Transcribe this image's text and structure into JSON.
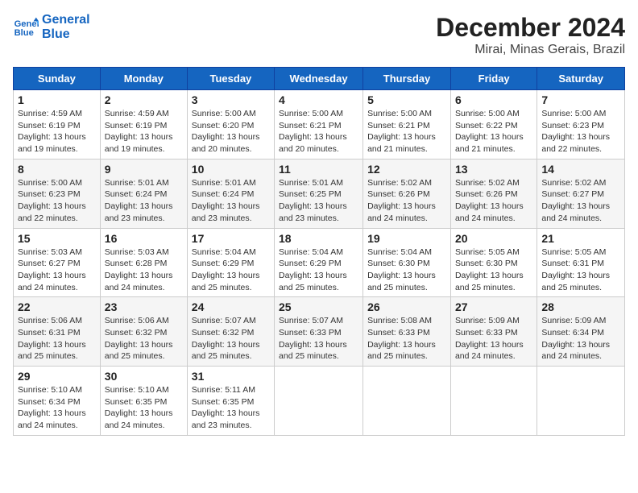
{
  "header": {
    "logo_line1": "General",
    "logo_line2": "Blue",
    "month": "December 2024",
    "location": "Mirai, Minas Gerais, Brazil"
  },
  "weekdays": [
    "Sunday",
    "Monday",
    "Tuesday",
    "Wednesday",
    "Thursday",
    "Friday",
    "Saturday"
  ],
  "weeks": [
    [
      {
        "day": 1,
        "detail": "Sunrise: 4:59 AM\nSunset: 6:19 PM\nDaylight: 13 hours\nand 19 minutes."
      },
      {
        "day": 2,
        "detail": "Sunrise: 4:59 AM\nSunset: 6:19 PM\nDaylight: 13 hours\nand 19 minutes."
      },
      {
        "day": 3,
        "detail": "Sunrise: 5:00 AM\nSunset: 6:20 PM\nDaylight: 13 hours\nand 20 minutes."
      },
      {
        "day": 4,
        "detail": "Sunrise: 5:00 AM\nSunset: 6:21 PM\nDaylight: 13 hours\nand 20 minutes."
      },
      {
        "day": 5,
        "detail": "Sunrise: 5:00 AM\nSunset: 6:21 PM\nDaylight: 13 hours\nand 21 minutes."
      },
      {
        "day": 6,
        "detail": "Sunrise: 5:00 AM\nSunset: 6:22 PM\nDaylight: 13 hours\nand 21 minutes."
      },
      {
        "day": 7,
        "detail": "Sunrise: 5:00 AM\nSunset: 6:23 PM\nDaylight: 13 hours\nand 22 minutes."
      }
    ],
    [
      {
        "day": 8,
        "detail": "Sunrise: 5:00 AM\nSunset: 6:23 PM\nDaylight: 13 hours\nand 22 minutes."
      },
      {
        "day": 9,
        "detail": "Sunrise: 5:01 AM\nSunset: 6:24 PM\nDaylight: 13 hours\nand 23 minutes."
      },
      {
        "day": 10,
        "detail": "Sunrise: 5:01 AM\nSunset: 6:24 PM\nDaylight: 13 hours\nand 23 minutes."
      },
      {
        "day": 11,
        "detail": "Sunrise: 5:01 AM\nSunset: 6:25 PM\nDaylight: 13 hours\nand 23 minutes."
      },
      {
        "day": 12,
        "detail": "Sunrise: 5:02 AM\nSunset: 6:26 PM\nDaylight: 13 hours\nand 24 minutes."
      },
      {
        "day": 13,
        "detail": "Sunrise: 5:02 AM\nSunset: 6:26 PM\nDaylight: 13 hours\nand 24 minutes."
      },
      {
        "day": 14,
        "detail": "Sunrise: 5:02 AM\nSunset: 6:27 PM\nDaylight: 13 hours\nand 24 minutes."
      }
    ],
    [
      {
        "day": 15,
        "detail": "Sunrise: 5:03 AM\nSunset: 6:27 PM\nDaylight: 13 hours\nand 24 minutes."
      },
      {
        "day": 16,
        "detail": "Sunrise: 5:03 AM\nSunset: 6:28 PM\nDaylight: 13 hours\nand 24 minutes."
      },
      {
        "day": 17,
        "detail": "Sunrise: 5:04 AM\nSunset: 6:29 PM\nDaylight: 13 hours\nand 25 minutes."
      },
      {
        "day": 18,
        "detail": "Sunrise: 5:04 AM\nSunset: 6:29 PM\nDaylight: 13 hours\nand 25 minutes."
      },
      {
        "day": 19,
        "detail": "Sunrise: 5:04 AM\nSunset: 6:30 PM\nDaylight: 13 hours\nand 25 minutes."
      },
      {
        "day": 20,
        "detail": "Sunrise: 5:05 AM\nSunset: 6:30 PM\nDaylight: 13 hours\nand 25 minutes."
      },
      {
        "day": 21,
        "detail": "Sunrise: 5:05 AM\nSunset: 6:31 PM\nDaylight: 13 hours\nand 25 minutes."
      }
    ],
    [
      {
        "day": 22,
        "detail": "Sunrise: 5:06 AM\nSunset: 6:31 PM\nDaylight: 13 hours\nand 25 minutes."
      },
      {
        "day": 23,
        "detail": "Sunrise: 5:06 AM\nSunset: 6:32 PM\nDaylight: 13 hours\nand 25 minutes."
      },
      {
        "day": 24,
        "detail": "Sunrise: 5:07 AM\nSunset: 6:32 PM\nDaylight: 13 hours\nand 25 minutes."
      },
      {
        "day": 25,
        "detail": "Sunrise: 5:07 AM\nSunset: 6:33 PM\nDaylight: 13 hours\nand 25 minutes."
      },
      {
        "day": 26,
        "detail": "Sunrise: 5:08 AM\nSunset: 6:33 PM\nDaylight: 13 hours\nand 25 minutes."
      },
      {
        "day": 27,
        "detail": "Sunrise: 5:09 AM\nSunset: 6:33 PM\nDaylight: 13 hours\nand 24 minutes."
      },
      {
        "day": 28,
        "detail": "Sunrise: 5:09 AM\nSunset: 6:34 PM\nDaylight: 13 hours\nand 24 minutes."
      }
    ],
    [
      {
        "day": 29,
        "detail": "Sunrise: 5:10 AM\nSunset: 6:34 PM\nDaylight: 13 hours\nand 24 minutes."
      },
      {
        "day": 30,
        "detail": "Sunrise: 5:10 AM\nSunset: 6:35 PM\nDaylight: 13 hours\nand 24 minutes."
      },
      {
        "day": 31,
        "detail": "Sunrise: 5:11 AM\nSunset: 6:35 PM\nDaylight: 13 hours\nand 23 minutes."
      },
      null,
      null,
      null,
      null
    ]
  ]
}
